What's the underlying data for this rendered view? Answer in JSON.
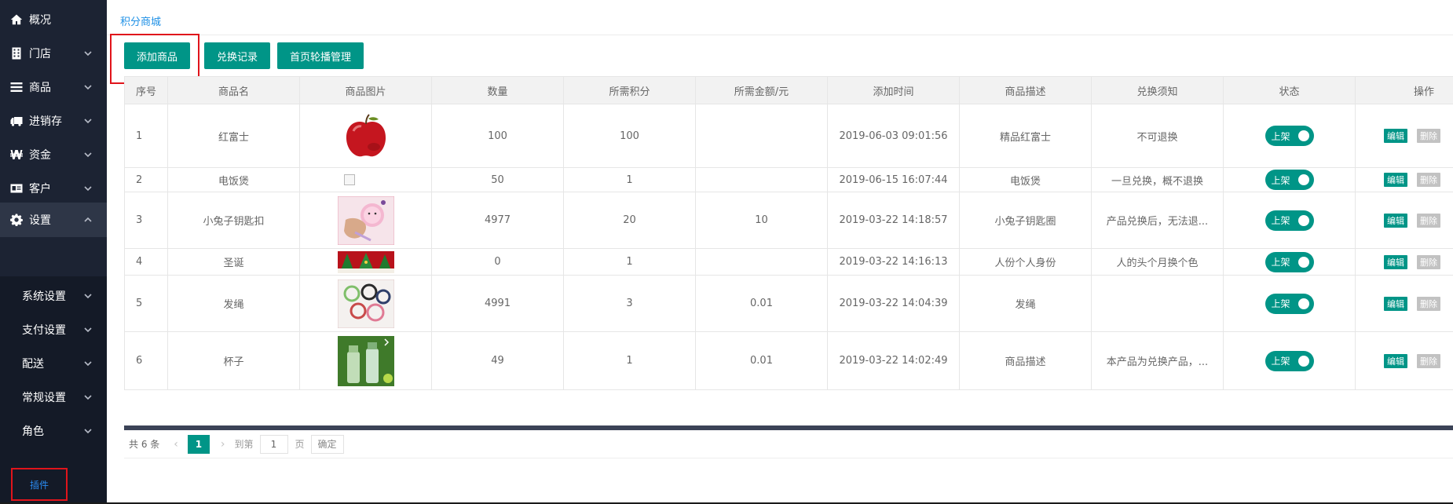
{
  "sidebar": {
    "items": [
      {
        "label": "概况",
        "icon": "home-icon"
      },
      {
        "label": "门店",
        "icon": "building-icon"
      },
      {
        "label": "商品",
        "icon": "list-icon"
      },
      {
        "label": "进销存",
        "icon": "truck-icon"
      },
      {
        "label": "资金",
        "icon": "won-icon"
      },
      {
        "label": "客户",
        "icon": "id-card-icon"
      },
      {
        "label": "设置",
        "icon": "gear-icon"
      }
    ],
    "sub_items": [
      {
        "label": "系统设置"
      },
      {
        "label": "支付设置"
      },
      {
        "label": "配送"
      },
      {
        "label": "常规设置"
      },
      {
        "label": "角色"
      }
    ],
    "plugin_label": "插件"
  },
  "breadcrumb": "积分商城",
  "toolbar": {
    "add_label": "添加商品",
    "records_label": "兑换记录",
    "carousel_label": "首页轮播管理"
  },
  "table": {
    "headers": [
      "序号",
      "商品名",
      "商品图片",
      "数量",
      "所需积分",
      "所需金额/元",
      "添加时间",
      "商品描述",
      "兑换须知",
      "状态",
      "操作"
    ],
    "rows": [
      {
        "idx": "1",
        "name": "红富士",
        "image": "apple",
        "qty": "100",
        "points": "100",
        "amount": "",
        "time": "2019-06-03 09:01:56",
        "desc": "精品红富士",
        "notice": "不可退换",
        "status": "上架"
      },
      {
        "idx": "2",
        "name": "电饭煲",
        "image": "broken",
        "qty": "50",
        "points": "1",
        "amount": "",
        "time": "2019-06-15 16:07:44",
        "desc": "电饭煲",
        "notice": "一旦兑换，概不退换",
        "status": "上架"
      },
      {
        "idx": "3",
        "name": "小兔子钥匙扣",
        "image": "bunny",
        "qty": "4977",
        "points": "20",
        "amount": "10",
        "time": "2019-03-22 14:18:57",
        "desc": "小兔子钥匙圈",
        "notice": "产品兑换后，无法退...",
        "status": "上架"
      },
      {
        "idx": "4",
        "name": "圣诞",
        "image": "christmas",
        "qty": "0",
        "points": "1",
        "amount": "",
        "time": "2019-03-22 14:16:13",
        "desc": "人份个人身份",
        "notice": "人的头个月换个色",
        "status": "上架"
      },
      {
        "idx": "5",
        "name": "发绳",
        "image": "hairties",
        "qty": "4991",
        "points": "3",
        "amount": "0.01",
        "time": "2019-03-22 14:04:39",
        "desc": "发绳",
        "notice": "",
        "status": "上架"
      },
      {
        "idx": "6",
        "name": "杯子",
        "image": "bottles",
        "qty": "49",
        "points": "1",
        "amount": "0.01",
        "time": "2019-03-22 14:02:49",
        "desc": "商品描述",
        "notice": "本产品为兑换产品，...",
        "status": "上架"
      }
    ],
    "edit_label": "编辑",
    "delete_label": "删除"
  },
  "pagination": {
    "total": "共 6 条",
    "current": "1",
    "goto_label": "到第",
    "goto_value": "1",
    "page_unit": "页",
    "confirm_label": "确定"
  },
  "colors": {
    "sidebar_bg": "#1c2333",
    "accent": "#009587",
    "highlight_border": "#e0141b",
    "link": "#1e90e6"
  }
}
